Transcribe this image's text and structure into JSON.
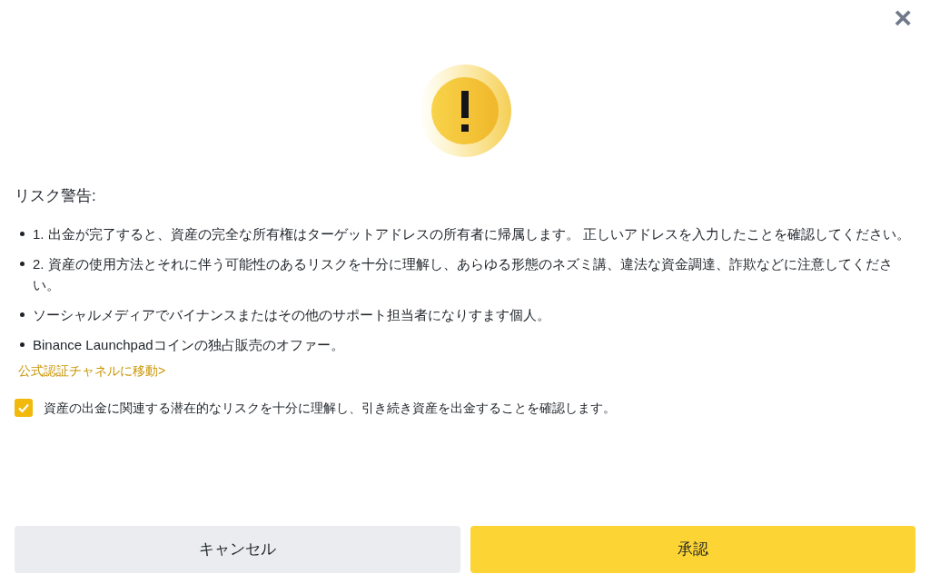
{
  "close_button": {
    "label": "×"
  },
  "title": "リスク警告:",
  "warnings": [
    "1. 出金が完了すると、資産の完全な所有権はターゲットアドレスの所有者に帰属します。 正しいアドレスを入力したことを確認してください。",
    "2. 資産の使用方法とそれに伴う可能性のあるリスクを十分に理解し、あらゆる形態のネズミ講、違法な資金調達、詐欺などに注意してください。",
    "ソーシャルメディアでバイナンスまたはその他のサポート担当者になりすます個人。",
    "Binance Launchpadコインの独占販売のオファー。"
  ],
  "link": "公式認証チャネルに移動>",
  "confirmation": {
    "label": "資産の出金に関連する潜在的なリスクを十分に理解し、引き続き資産を出金することを確認します。",
    "checked": true
  },
  "buttons": [
    {
      "label": "キャンセル",
      "kind": "secondary"
    },
    {
      "label": "承認",
      "kind": "primary"
    }
  ]
}
